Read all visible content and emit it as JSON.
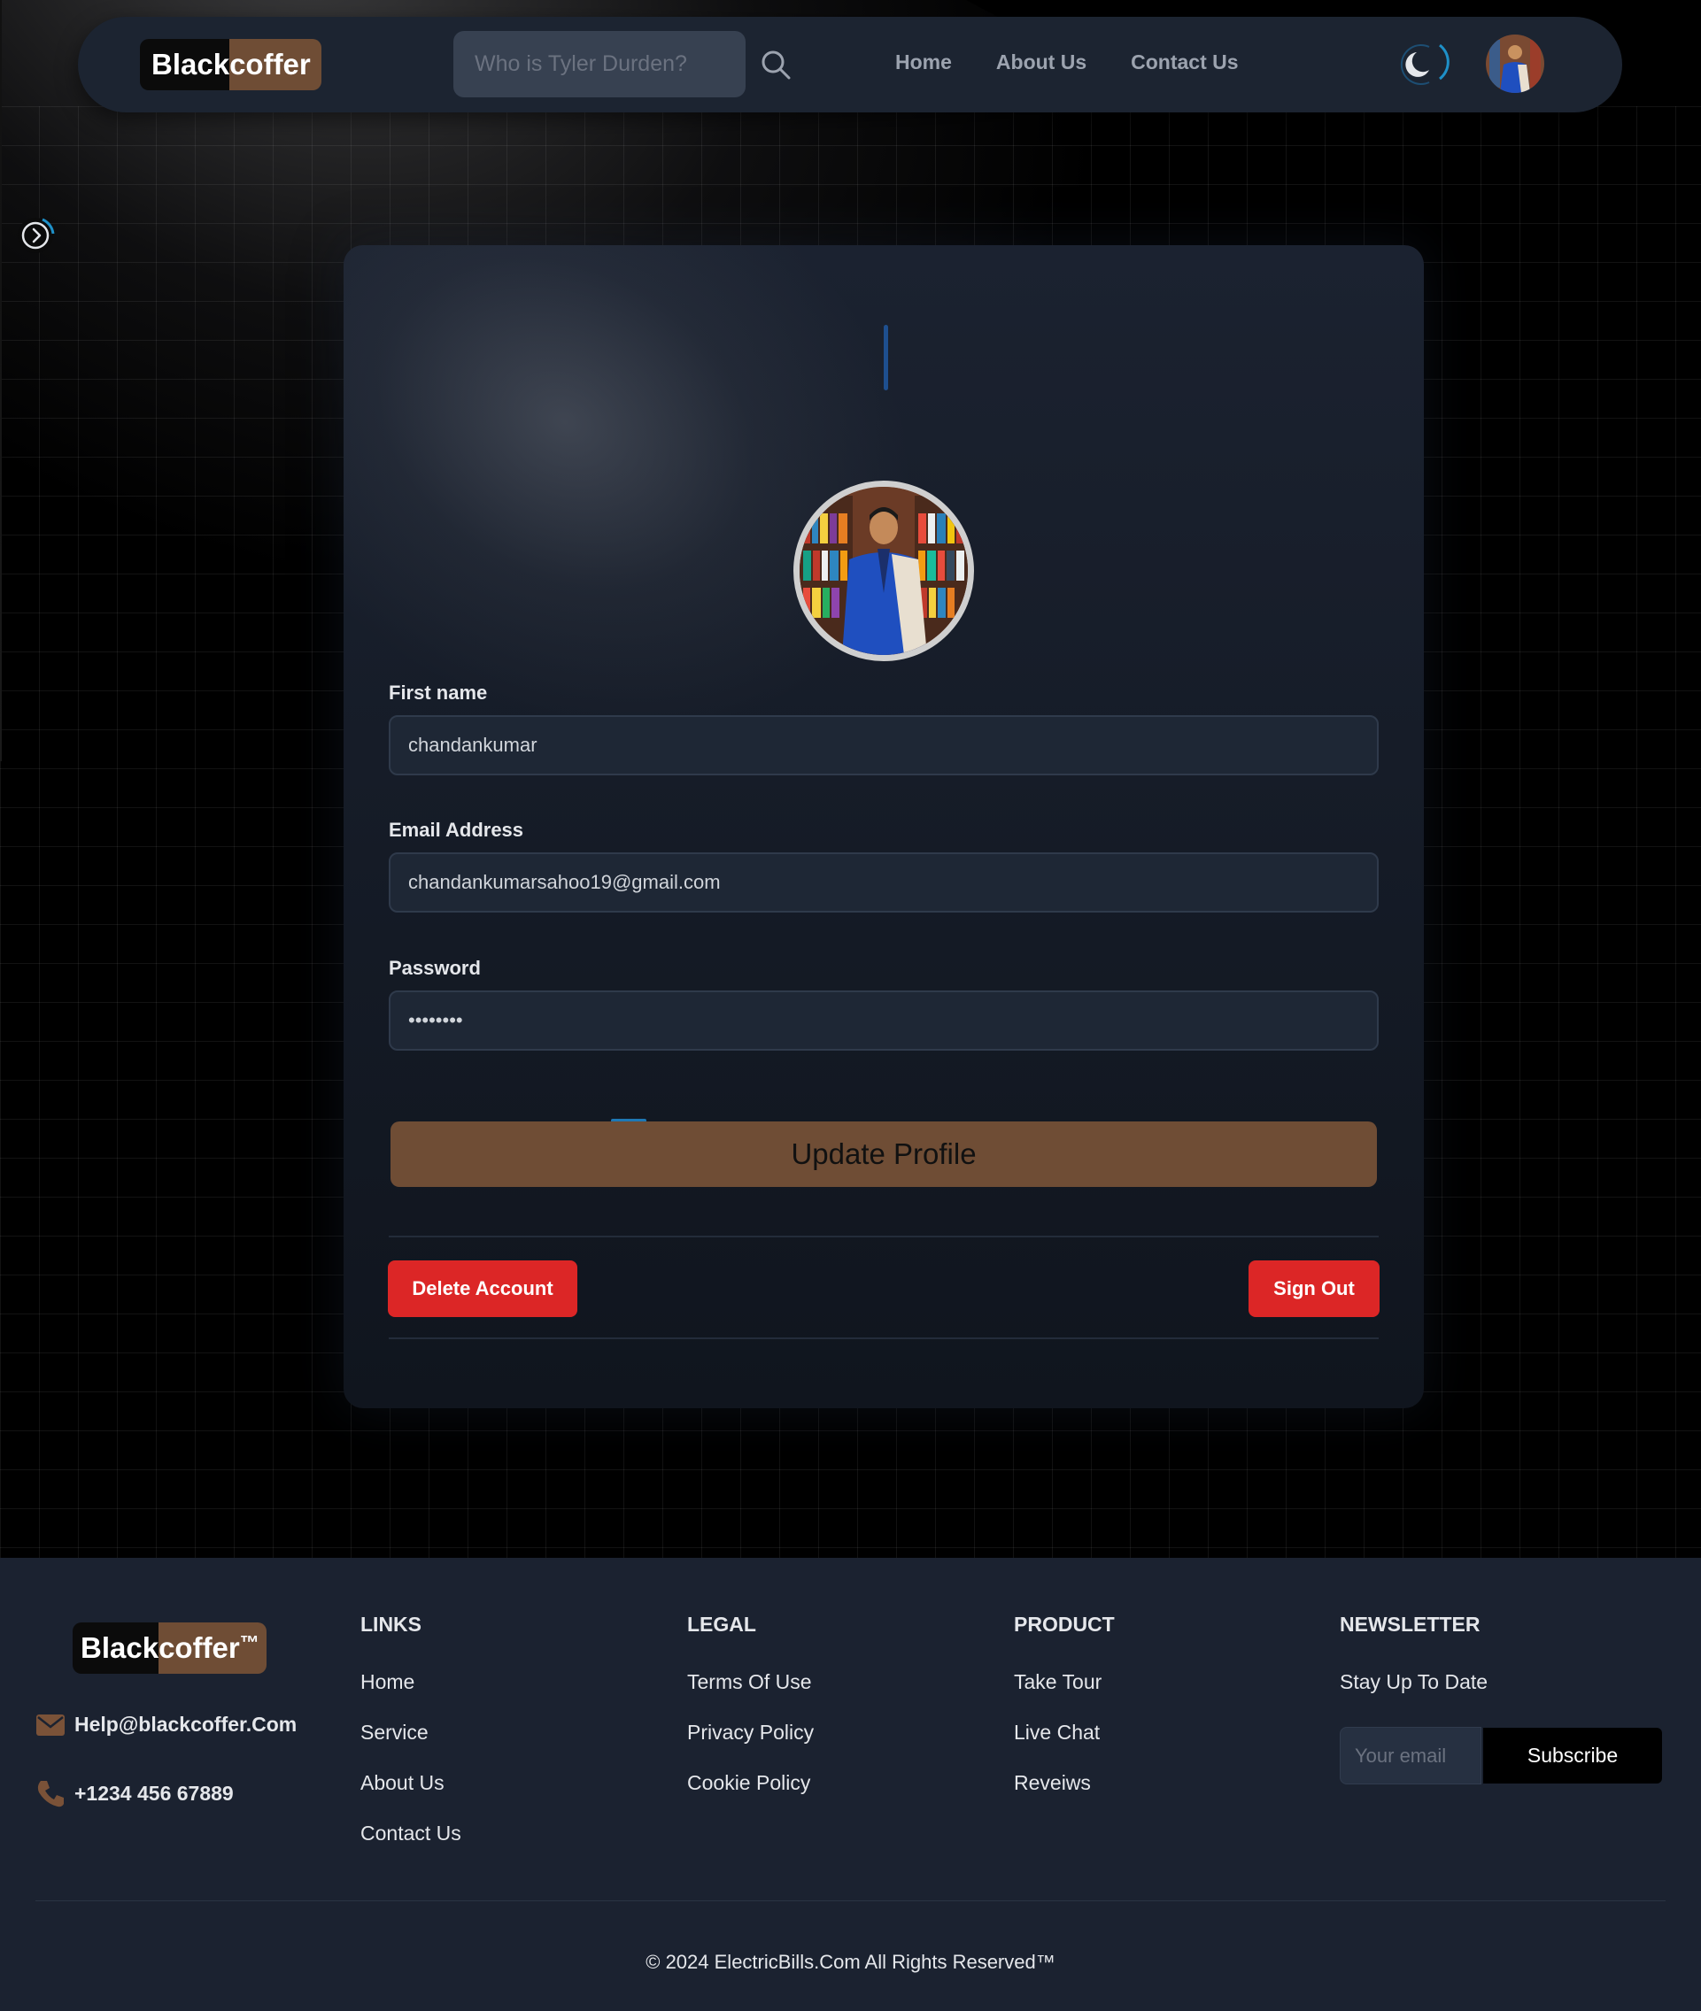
{
  "brand": {
    "part1": "Black",
    "part2": "coffer",
    "tm": "™"
  },
  "search": {
    "placeholder": "Who is Tyler Durden?"
  },
  "nav": {
    "links": [
      "Home",
      "About Us",
      "Contact Us"
    ]
  },
  "profile": {
    "first_name_label": "First name",
    "first_name_value": "chandankumar",
    "email_label": "Email Address",
    "email_value": "chandankumarsahoo19@gmail.com",
    "password_label": "Password",
    "password_value": "••••••••",
    "update_button": "Update Profile",
    "delete_button": "Delete Account",
    "signout_button": "Sign Out"
  },
  "footer": {
    "email": "Help@blackcoffer.Com",
    "phone": "+1234 456 67889",
    "columns": [
      {
        "title": "LINKS",
        "items": [
          "Home",
          "Service",
          "About Us",
          "Contact Us"
        ]
      },
      {
        "title": "LEGAL",
        "items": [
          "Terms Of Use",
          "Privacy Policy",
          "Cookie Policy"
        ]
      },
      {
        "title": "PRODUCT",
        "items": [
          "Take Tour",
          "Live Chat",
          "Reveiws"
        ]
      }
    ],
    "newsletter": {
      "title": "NEWSLETTER",
      "subtitle": "Stay Up To Date",
      "placeholder": "Your email",
      "button": "Subscribe"
    },
    "copyright": "© 2024 ElectricBills.Com All Rights Reserved™"
  },
  "colors": {
    "brand_brown": "#6f4d35",
    "danger": "#dc2626",
    "panel": "#1b2230"
  }
}
